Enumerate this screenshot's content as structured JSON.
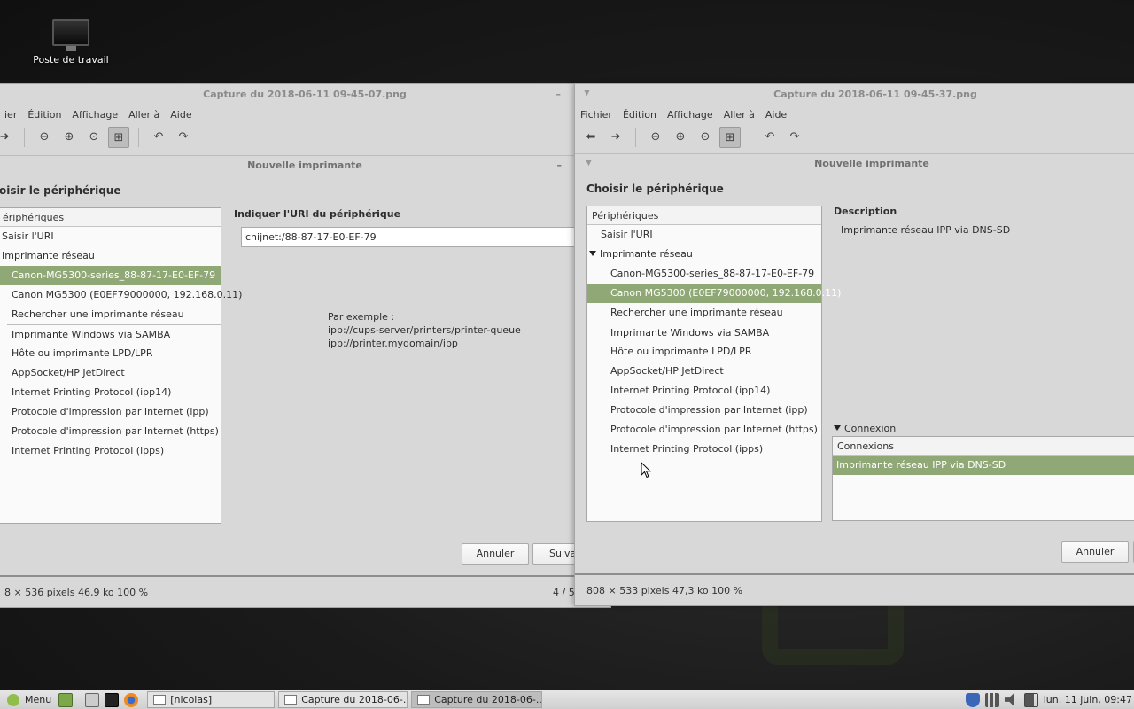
{
  "desktop": {
    "icon_label": "Poste de travail"
  },
  "left_window": {
    "title": "Capture du 2018-06-11 09-45-07.png",
    "minimize": "–",
    "menu": [
      "ier",
      "Édition",
      "Affichage",
      "Aller à",
      "Aide"
    ],
    "dialog": {
      "title": "Nouvelle imprimante",
      "minimize": "–",
      "heading": "oisir le périphérique",
      "list_header": "ériphériques",
      "items": [
        "Saisir l'URI",
        "Imprimante réseau",
        "Canon-MG5300-series_88-87-17-E0-EF-79",
        "Canon MG5300 (E0EF79000000, 192.168.0.11)",
        "Rechercher une imprimante réseau",
        "Imprimante Windows via SAMBA",
        "Hôte ou imprimante LPD/LPR",
        "AppSocket/HP JetDirect",
        "Internet Printing Protocol (ipp14)",
        "Protocole d'impression par Internet (ipp)",
        "Protocole d'impression par Internet (https)",
        "Internet Printing Protocol (ipps)"
      ],
      "uri_heading": "Indiquer l'URI du périphérique",
      "uri_value": "cnijnet:/88-87-17-E0-EF-79",
      "example_1": "Par exemple :",
      "example_2": "ipp://cups-server/printers/printer-queue",
      "example_3": "ipp://printer.mydomain/ipp",
      "cancel": "Annuler",
      "next": "Suivan"
    },
    "status": {
      "info": "8 × 536 pixels  46,9 ko    100 %",
      "page": "4 / 5"
    }
  },
  "right_window": {
    "title": "Capture du 2018-06-11 09-45-37.png",
    "menu": [
      "Fichier",
      "Édition",
      "Affichage",
      "Aller à",
      "Aide"
    ],
    "dialog": {
      "title": "Nouvelle imprimante",
      "heading": "Choisir le périphérique",
      "list_header": "Périphériques",
      "items": [
        "Saisir l'URI",
        "Imprimante réseau",
        "Canon-MG5300-series_88-87-17-E0-EF-79",
        "Canon MG5300 (E0EF79000000, 192.168.0.11)",
        "Rechercher une imprimante réseau",
        "Imprimante Windows via SAMBA",
        "Hôte ou imprimante LPD/LPR",
        "AppSocket/HP JetDirect",
        "Internet Printing Protocol (ipp14)",
        "Protocole d'impression par Internet (ipp)",
        "Protocole d'impression par Internet (https)",
        "Internet Printing Protocol (ipps)"
      ],
      "description_heading": "Description",
      "description_value": "Imprimante réseau IPP via DNS-SD",
      "connection_expander": "Connexion",
      "connections_header": "Connexions",
      "connection_item": "Imprimante réseau IPP via DNS-SD",
      "cancel": "Annuler"
    },
    "status": {
      "info": "808 × 533 pixels  47,3 ko    100 %"
    }
  },
  "taskbar": {
    "menu": "Menu",
    "tasks": [
      "[nicolas]",
      "Capture du 2018-06-...",
      "Capture du 2018-06-..."
    ],
    "clock": "lun. 11 juin, 09:47"
  },
  "colors": {
    "selection": "#8fa876",
    "window_bg": "#d8d8d8",
    "mint_green": "#8fbf4a"
  }
}
